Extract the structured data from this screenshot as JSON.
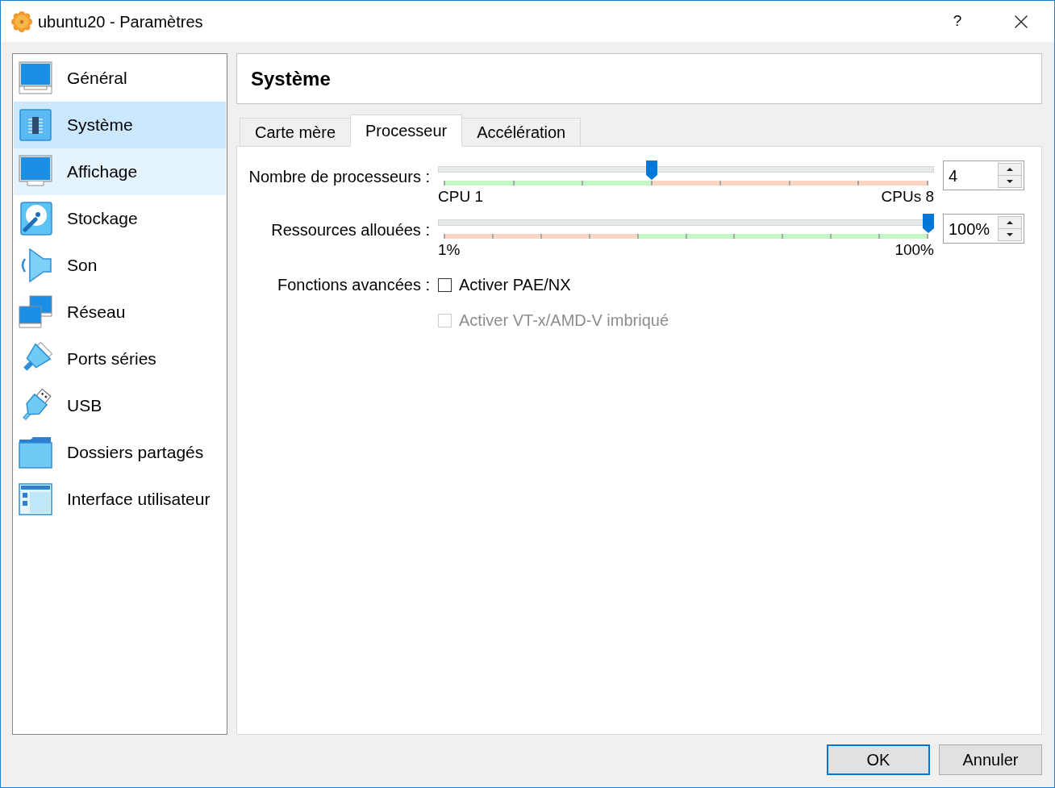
{
  "window": {
    "title": "ubuntu20 - Paramètres",
    "help": "?"
  },
  "sidebar": {
    "items": [
      {
        "label": "Général",
        "selected": false,
        "hovered": false
      },
      {
        "label": "Système",
        "selected": true,
        "hovered": false
      },
      {
        "label": "Affichage",
        "selected": false,
        "hovered": true
      },
      {
        "label": "Stockage",
        "selected": false,
        "hovered": false
      },
      {
        "label": "Son",
        "selected": false,
        "hovered": false
      },
      {
        "label": "Réseau",
        "selected": false,
        "hovered": false
      },
      {
        "label": "Ports séries",
        "selected": false,
        "hovered": false
      },
      {
        "label": "USB",
        "selected": false,
        "hovered": false
      },
      {
        "label": "Dossiers partagés",
        "selected": false,
        "hovered": false
      },
      {
        "label": "Interface utilisateur",
        "selected": false,
        "hovered": false
      }
    ]
  },
  "header": {
    "title": "Système"
  },
  "tabs": [
    {
      "label": "Carte mère",
      "selected": false
    },
    {
      "label": "Processeur",
      "selected": true
    },
    {
      "label": "Accélération",
      "selected": false
    }
  ],
  "processor": {
    "rows": [
      {
        "kind": "slider",
        "label": "Nombre de processeurs :",
        "level": 0.43,
        "min_label": "CPU 1",
        "max_label": "CPUs 8",
        "value": "4",
        "segments": [
          {
            "recommended": true
          },
          {
            "recommended": true
          },
          {
            "recommended": true
          },
          {
            "recommended": false
          },
          {
            "recommended": false
          },
          {
            "recommended": false
          },
          {
            "recommended": false
          }
        ]
      },
      {
        "kind": "slider",
        "label": "Ressources allouées :",
        "level": 1,
        "min_label": "1%",
        "max_label": "100%",
        "value": "100%",
        "segments": [
          {
            "recommended": false
          },
          {
            "recommended": false
          },
          {
            "recommended": false
          },
          {
            "recommended": false
          },
          {
            "recommended": true
          },
          {
            "recommended": true
          },
          {
            "recommended": true
          },
          {
            "recommended": true
          },
          {
            "recommended": true
          },
          {
            "recommended": true
          }
        ]
      },
      {
        "kind": "checkbox",
        "label": "Fonctions avancées :",
        "text": "Activer PAE/NX",
        "checked": false,
        "disabled": false
      },
      {
        "kind": "checkbox",
        "text": "Activer VT-x/AMD-V imbriqué",
        "checked": false,
        "disabled": true
      }
    ]
  },
  "buttons": [
    {
      "label": "OK",
      "default": true
    },
    {
      "label": "Annuler",
      "default": false
    }
  ]
}
